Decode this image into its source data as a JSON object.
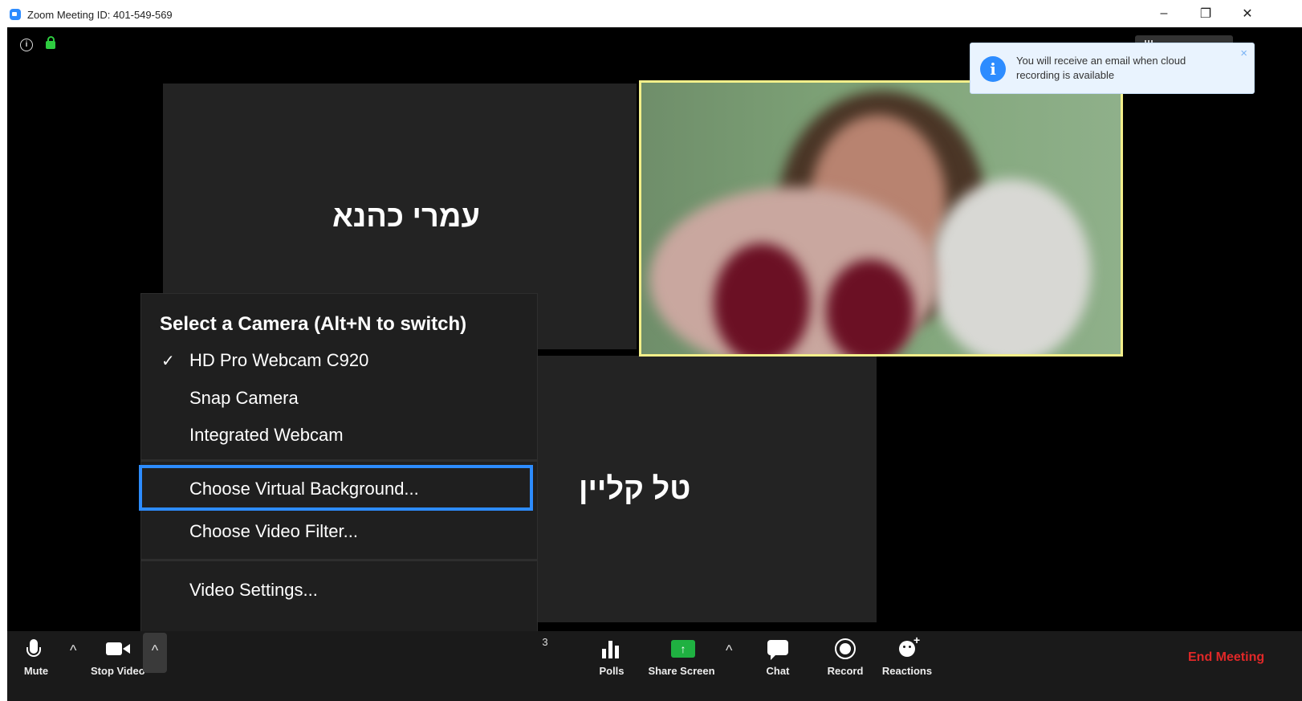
{
  "window": {
    "title": "Zoom Meeting ID: 401-549-569",
    "minimize_glyph": "–",
    "restore_glyph": "❐",
    "close_glyph": "✕"
  },
  "participants": {
    "tile1_name": "עמרי כהנא",
    "tile2_name": "טל קליין"
  },
  "notification": {
    "text": "You will receive an email when cloud recording is available",
    "icon": "info-icon",
    "close_glyph": "×"
  },
  "camera_menu": {
    "header": "Select a Camera (Alt+N to switch)",
    "cameras": [
      {
        "label": "HD Pro Webcam C920",
        "checked": true
      },
      {
        "label": "Snap Camera",
        "checked": false
      },
      {
        "label": "Integrated Webcam",
        "checked": false
      }
    ],
    "check_glyph": "✓",
    "virtual_background": "Choose Virtual Background...",
    "video_filter": "Choose Video Filter...",
    "video_settings": "Video Settings..."
  },
  "toolbar": {
    "mute": "Mute",
    "stop_video": "Stop Video",
    "participants_count": "3",
    "polls": "Polls",
    "share_screen": "Share Screen",
    "chat": "Chat",
    "record": "Record",
    "reactions": "Reactions",
    "end_meeting": "End Meeting",
    "caret_glyph": "^"
  },
  "colors": {
    "accent_blue": "#2d8cff",
    "end_red": "#e02828",
    "share_green": "#1fb141",
    "active_speaker_border": "#f3ef8a"
  }
}
